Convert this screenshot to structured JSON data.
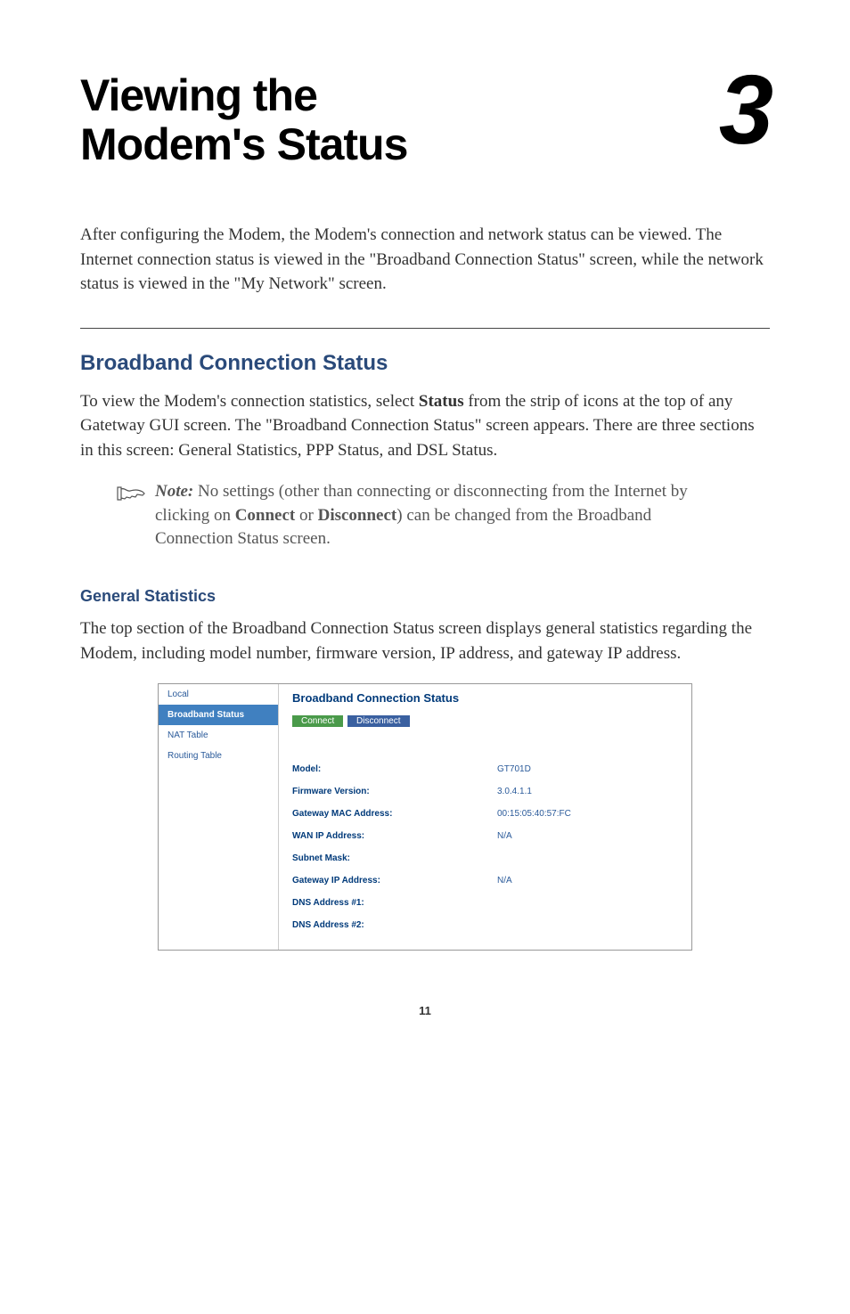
{
  "chapter": {
    "title": "Viewing the\nModem's Status",
    "number": "3"
  },
  "intro": "After configuring the Modem, the Modem's connection and network status can be viewed. The Internet connection status is viewed in the \"Broadband Connection Status\" screen, while the network status is viewed in the \"My Network\" screen.",
  "section": {
    "heading": "Broadband Connection Status",
    "body_pre": "To view the Modem's connection statistics, select ",
    "body_bold": "Status",
    "body_post": " from the strip of icons at the top of any Gatetway GUI screen. The \"Broadband Connection Status\" screen appears. There are three sections in this screen: General Statistics, PPP Status, and DSL Status."
  },
  "note": {
    "label": "Note:",
    "pre": " No settings (other than connecting or disconnecting from the Internet by clicking on ",
    "b1": "Connect",
    "mid": " or ",
    "b2": "Disconnect",
    "post": ") can be changed from the Broadband Connection Status screen."
  },
  "subsection": {
    "heading": "General Statistics",
    "body": "The top section of the Broadband Connection Status screen displays general statistics regarding the Modem, including model number, firmware version, IP address, and gateway IP address."
  },
  "screenshot": {
    "sidebar": {
      "items": [
        {
          "label": "Local",
          "active": false
        },
        {
          "label": "Broadband Status",
          "active": true
        },
        {
          "label": "NAT Table",
          "active": false
        },
        {
          "label": "Routing Table",
          "active": false
        }
      ]
    },
    "title": "Broadband Connection Status",
    "buttons": {
      "connect": "Connect",
      "disconnect": "Disconnect"
    },
    "rows": [
      {
        "label": "Model:",
        "value": "GT701D"
      },
      {
        "label": "Firmware Version:",
        "value": "3.0.4.1.1"
      },
      {
        "label": "Gateway MAC Address:",
        "value": "00:15:05:40:57:FC"
      },
      {
        "label": "WAN IP Address:",
        "value": "N/A"
      },
      {
        "label": "Subnet Mask:",
        "value": ""
      },
      {
        "label": "Gateway IP Address:",
        "value": "N/A"
      },
      {
        "label": "DNS Address #1:",
        "value": ""
      },
      {
        "label": "DNS Address #2:",
        "value": ""
      }
    ]
  },
  "page_number": "11"
}
